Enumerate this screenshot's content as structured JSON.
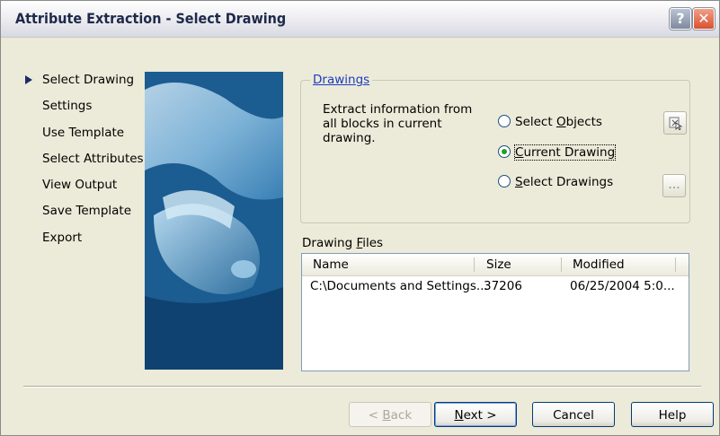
{
  "window": {
    "title": "Attribute Extraction - Select Drawing",
    "help_glyph": "?",
    "close_glyph": "✕"
  },
  "nav": {
    "items": [
      {
        "label": "Select Drawing",
        "active": true
      },
      {
        "label": "Settings",
        "active": false
      },
      {
        "label": "Use Template",
        "active": false
      },
      {
        "label": "Select Attributes",
        "active": false
      },
      {
        "label": "View Output",
        "active": false
      },
      {
        "label": "Save Template",
        "active": false
      },
      {
        "label": "Export",
        "active": false
      }
    ]
  },
  "drawings": {
    "group_title": "Drawings",
    "description": "Extract information from all blocks in current drawing.",
    "options": [
      {
        "pre": "Select ",
        "acc": "O",
        "post": "bjects",
        "selected": false
      },
      {
        "pre": "",
        "acc": "C",
        "post": "urrent Drawing",
        "selected": true
      },
      {
        "pre": "",
        "acc": "S",
        "post": "elect Drawings",
        "selected": false
      }
    ],
    "pick_button_icon": "select-objects-icon",
    "browse_button_label": "..."
  },
  "files": {
    "label_pre": "Drawing ",
    "label_acc": "F",
    "label_post": "iles",
    "columns": [
      "Name",
      "Size",
      "Modified"
    ],
    "rows": [
      {
        "name": "C:\\Documents and Settings...",
        "size": "37206",
        "modified": "06/25/2004 5:0..."
      }
    ]
  },
  "buttons": {
    "back": {
      "pre": "< ",
      "acc": "B",
      "post": "ack"
    },
    "next": {
      "pre": "",
      "acc": "N",
      "post": "ext >"
    },
    "cancel": "Cancel",
    "help": "Help"
  },
  "colors": {
    "dialog_bg": "#ecead8",
    "group_title": "#1c3cc0",
    "radio_dot": "#21a121",
    "nav_arrow": "#1c2a6a"
  }
}
